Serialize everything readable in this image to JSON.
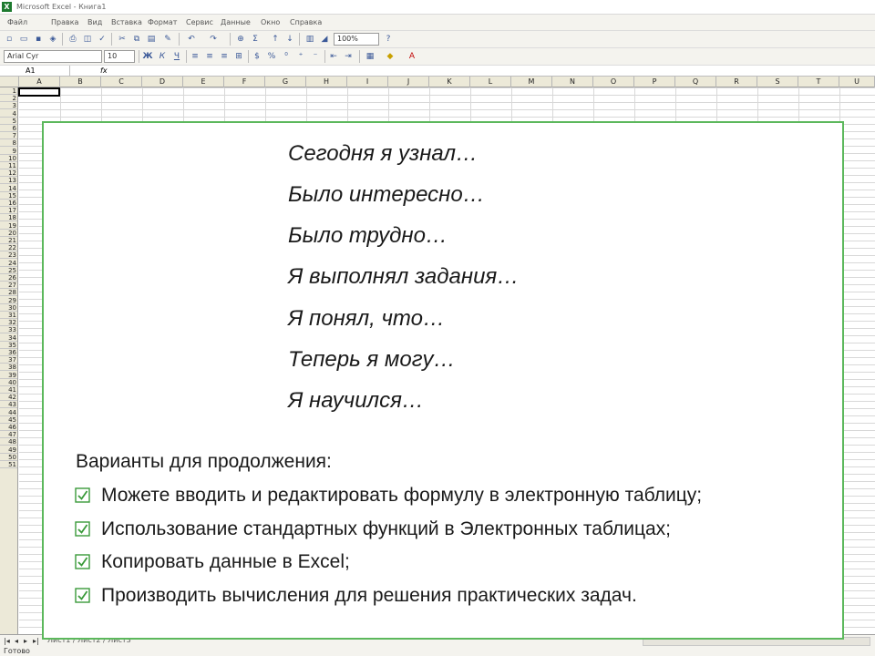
{
  "window": {
    "title": "Microsoft Excel - Книга1"
  },
  "menu": {
    "items": [
      "Файл",
      "Правка",
      "Вид",
      "Вставка",
      "Формат",
      "Сервис",
      "Данные",
      "Окно",
      "Справка"
    ]
  },
  "toolbar": {
    "zoom": "100%",
    "font_name": "Arial Cyr",
    "font_size": "10"
  },
  "formula_bar": {
    "cell_ref": "A1",
    "fx": "fx"
  },
  "columns": [
    "A",
    "B",
    "C",
    "D",
    "E",
    "F",
    "G",
    "H",
    "I",
    "J",
    "K",
    "L",
    "M",
    "N",
    "O",
    "P",
    "Q",
    "R",
    "S",
    "T",
    "U"
  ],
  "rows": [
    "1",
    "2",
    "3",
    "4",
    "5",
    "6",
    "7",
    "8",
    "9",
    "10",
    "11",
    "12",
    "13",
    "14",
    "15",
    "16",
    "17",
    "18",
    "19",
    "20",
    "21",
    "22",
    "23",
    "24",
    "25",
    "26",
    "27",
    "28",
    "29",
    "30",
    "31",
    "32",
    "33",
    "34",
    "35",
    "36",
    "37",
    "38",
    "39",
    "40",
    "41",
    "42",
    "43",
    "44",
    "45",
    "46",
    "47",
    "48",
    "49",
    "50",
    "51"
  ],
  "slide": {
    "phrases": [
      "Сегодня я узнал…",
      "Было интересно…",
      "Было трудно…",
      "Я выполнял задания…",
      "Я понял, что…",
      "Теперь я могу…",
      "Я научился…"
    ],
    "options_heading": "Варианты для продолжения:",
    "options": [
      "Можете вводить и редактировать формулу в электронную таблицу;",
      "Использование стандартных функций в Электронных таблицах;",
      "Копировать данные в Excel;",
      "Производить вычисления для решения практических задач."
    ]
  },
  "sheet_tabs": {
    "label": "Лист1 / Лист2 / Лист3"
  },
  "status": {
    "text": "Готово"
  },
  "colors": {
    "slide_border": "#5cb85c",
    "check": "#3a9a3a"
  }
}
